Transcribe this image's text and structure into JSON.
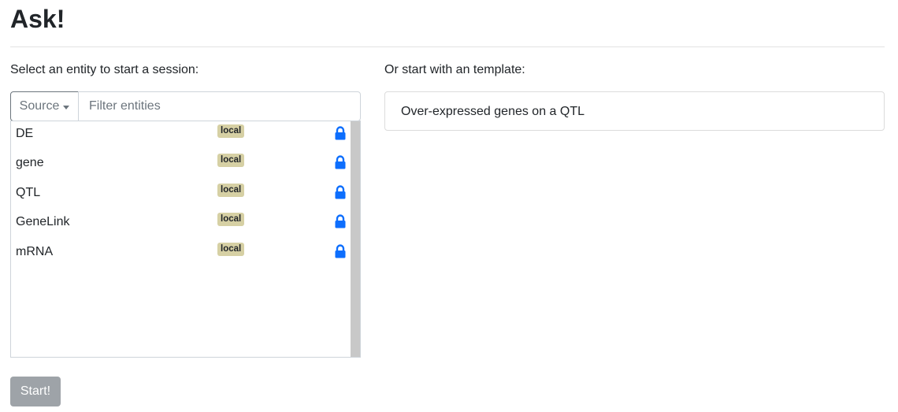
{
  "page": {
    "title": "Ask!"
  },
  "left": {
    "heading": "Select an entity to start a session:",
    "source_label": "Source",
    "filter_placeholder": "Filter entities",
    "entities": [
      {
        "name": "DE",
        "badge": "local",
        "icon": "lock-icon"
      },
      {
        "name": "gene",
        "badge": "local",
        "icon": "lock-icon"
      },
      {
        "name": "QTL",
        "badge": "local",
        "icon": "lock-icon"
      },
      {
        "name": "GeneLink",
        "badge": "local",
        "icon": "lock-icon"
      },
      {
        "name": "mRNA",
        "badge": "local",
        "icon": "lock-icon"
      }
    ]
  },
  "right": {
    "heading": "Or start with an template:",
    "templates": [
      {
        "label": "Over-expressed genes on a QTL"
      }
    ]
  },
  "actions": {
    "start_label": "Start!"
  },
  "colors": {
    "accent": "#0d6efd",
    "badge_bg": "#d6d0a4",
    "start_disabled": "#9ea3a8"
  }
}
